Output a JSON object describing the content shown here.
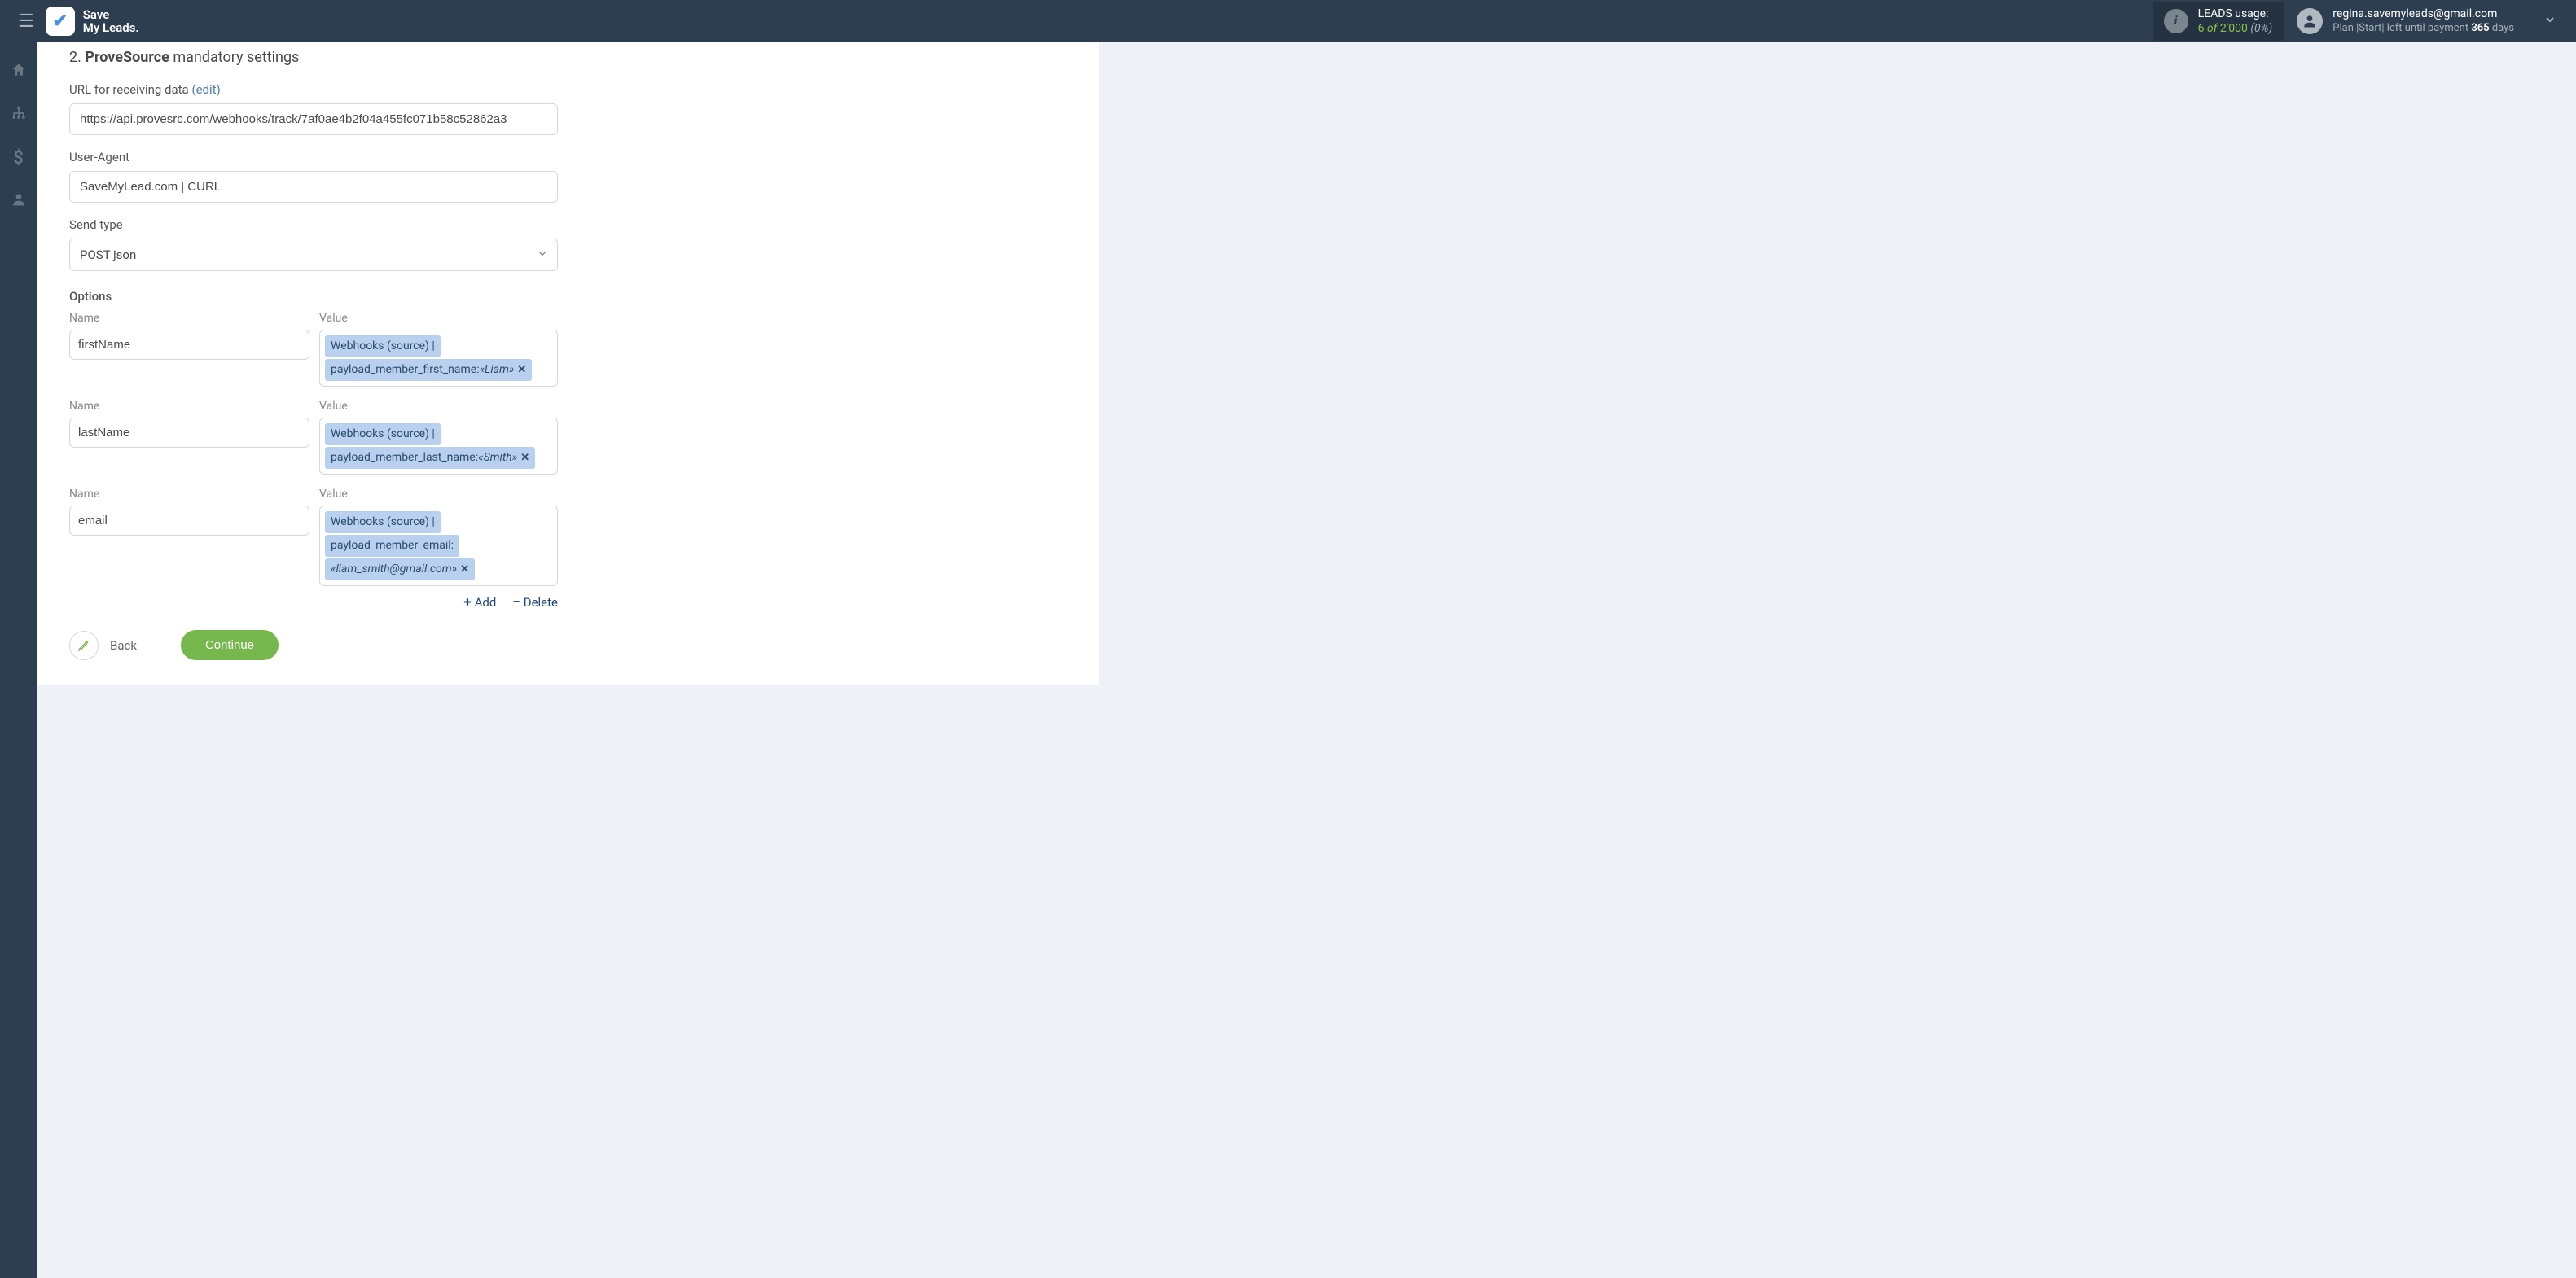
{
  "brand": {
    "line1": "Save",
    "line2": "My Leads."
  },
  "leads": {
    "label": "LEADS usage:",
    "used": "6",
    "of": "of",
    "total": "2'000",
    "pct": "(0%)"
  },
  "user": {
    "email": "regina.savemyleads@gmail.com",
    "plan_prefix": "Plan |Start| left until payment ",
    "days": "365",
    "days_suffix": " days"
  },
  "section": {
    "num": "2.",
    "title_strong": "ProveSource",
    "title_rest": "mandatory settings"
  },
  "fields": {
    "url_label": "URL for receiving data ",
    "url_edit": "(edit)",
    "url_value": "https://api.provesrc.com/webhooks/track/7af0ae4b2f04a455fc071b58c52862a3",
    "ua_label": "User-Agent",
    "ua_value": "SaveMyLead.com | CURL",
    "send_label": "Send type",
    "send_value": "POST json"
  },
  "options": {
    "header": "Options",
    "name_label": "Name",
    "value_label": "Value",
    "rows": [
      {
        "name": "firstName",
        "tok1": "Webhooks (source) |",
        "tok2a": "payload_member_first_name: ",
        "tok2b": "«Liam»"
      },
      {
        "name": "lastName",
        "tok1": "Webhooks (source) |",
        "tok2a": "payload_member_last_name: ",
        "tok2b": "«Smith»"
      },
      {
        "name": "email",
        "tok1": "Webhooks (source) |",
        "tok2a": "payload_member_email:",
        "tok2b": "«liam_smith@gmail.com»"
      }
    ],
    "add": "Add",
    "delete": "Delete"
  },
  "buttons": {
    "back": "Back",
    "continue": "Continue"
  }
}
